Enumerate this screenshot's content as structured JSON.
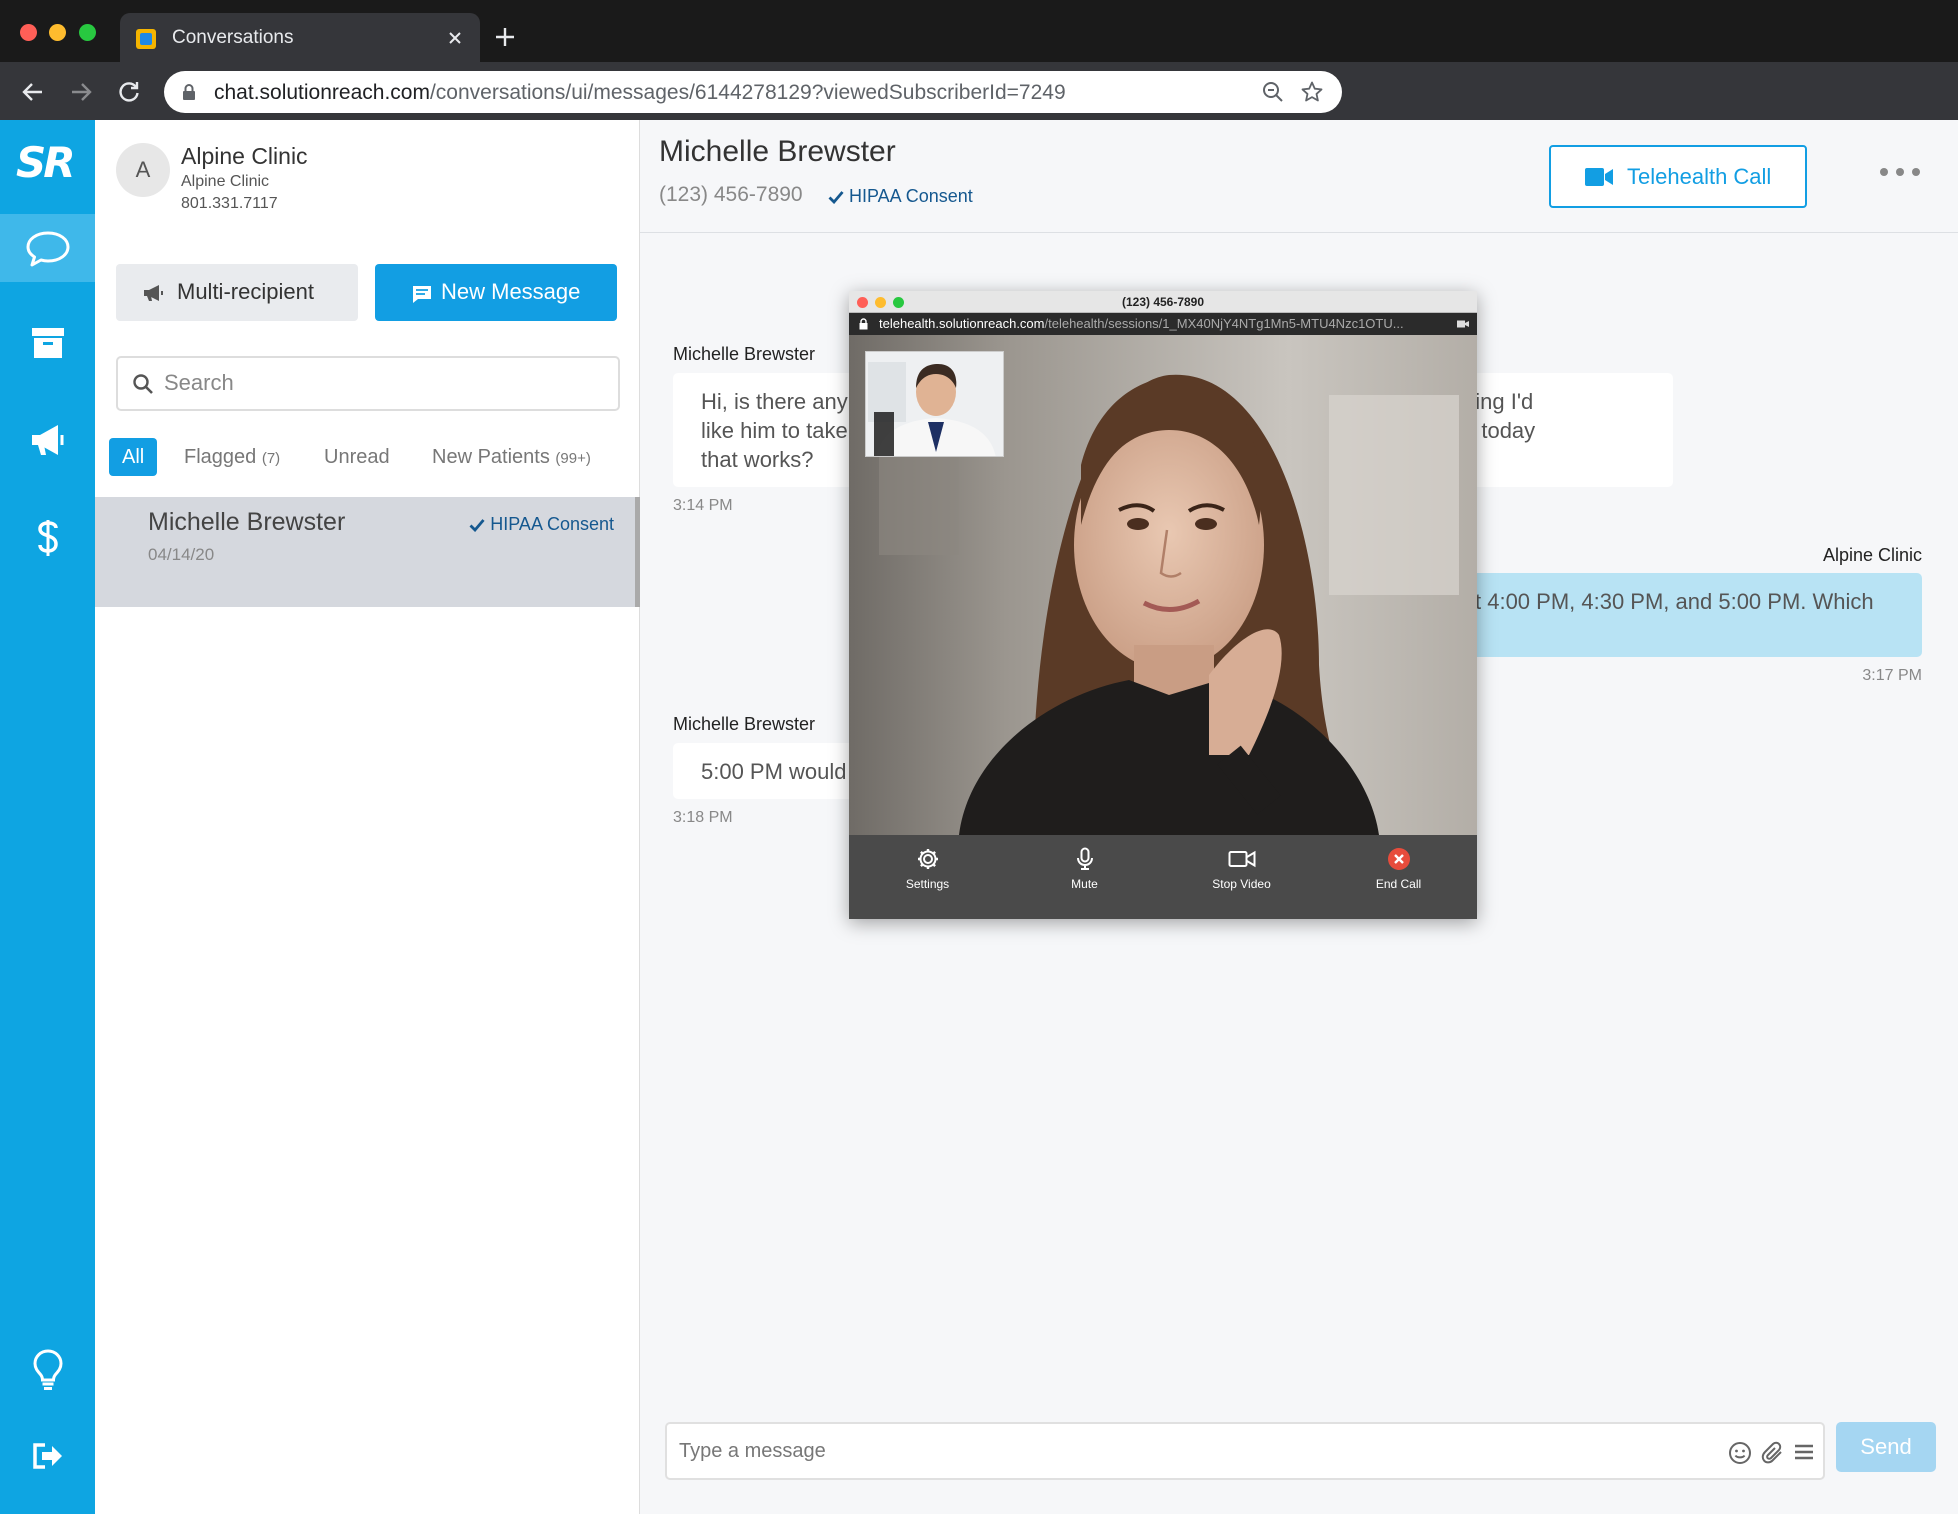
{
  "browser": {
    "tab_title": "Conversations",
    "url_host": "chat.solutionreach.com",
    "url_path": "/conversations/ui/messages/6144278129?viewedSubscriberId=7249",
    "icons": [
      "close-icon",
      "plus-icon",
      "back-icon",
      "forward-icon",
      "reload-icon",
      "lock-icon",
      "zoom-icon",
      "star-icon"
    ]
  },
  "rail": {
    "logo": "SR",
    "items": [
      {
        "name": "chat-icon",
        "active": true
      },
      {
        "name": "archive-icon",
        "active": false
      },
      {
        "name": "megaphone-icon",
        "active": false
      },
      {
        "name": "dollar-icon",
        "active": false
      },
      {
        "name": "lightbulb-icon",
        "active": false
      },
      {
        "name": "logout-icon",
        "active": false
      }
    ],
    "color": "#0ea5e2"
  },
  "account": {
    "avatar_letter": "A",
    "name": "Alpine Clinic",
    "subtitle": "Alpine Clinic",
    "phone": "801.331.7117"
  },
  "actions": {
    "multi_label": "Multi-recipient",
    "new_label": "New Message"
  },
  "search": {
    "placeholder": "Search"
  },
  "filters": {
    "all": "All",
    "flagged": "Flagged",
    "flagged_count": "(7)",
    "unread": "Unread",
    "new_patients": "New Patients",
    "new_patients_count": "(99+)"
  },
  "conversation_list": [
    {
      "name": "Michelle Brewster",
      "date": "04/14/20",
      "badge": "HIPAA Consent"
    }
  ],
  "contact": {
    "name": "Michelle Brewster",
    "phone": "(123) 456-7890",
    "badge": "HIPAA Consent",
    "telehealth_label": "Telehealth Call"
  },
  "messages": [
    {
      "sender": "Michelle Brewster",
      "line1": "Hi, is there any",
      "line2": "like him to take",
      "line3": "that works?",
      "right1": "hing I'd",
      "right2": "e today",
      "time": "3:14 PM"
    },
    {
      "sender": "Alpine Clinic",
      "text": "t 4:00 PM, 4:30 PM, and 5:00 PM. Which",
      "time": "3:17 PM"
    },
    {
      "sender": "Michelle Brewster",
      "text": "5:00 PM would",
      "time": "3:18 PM"
    }
  ],
  "composer": {
    "placeholder": "Type a message",
    "send_label": "Send"
  },
  "video": {
    "title": "(123) 456-7890",
    "url_host": "telehealth.solutionreach.com",
    "url_path": "/telehealth/sessions/1_MX40NjY4NTg1Mn5-MTU4Nzc1OTU...",
    "controls": [
      {
        "label": "Settings",
        "icon": "gear-icon"
      },
      {
        "label": "Mute",
        "icon": "microphone-icon"
      },
      {
        "label": "Stop Video",
        "icon": "video-camera-icon"
      },
      {
        "label": "End Call",
        "icon": "end-call-icon"
      }
    ]
  },
  "colors": {
    "accent": "#129ee3",
    "rail": "#0ea5e2",
    "hipaa": "#15588f",
    "outgoing_bubble": "#b8e3f4",
    "end_call": "#e74c3c"
  }
}
